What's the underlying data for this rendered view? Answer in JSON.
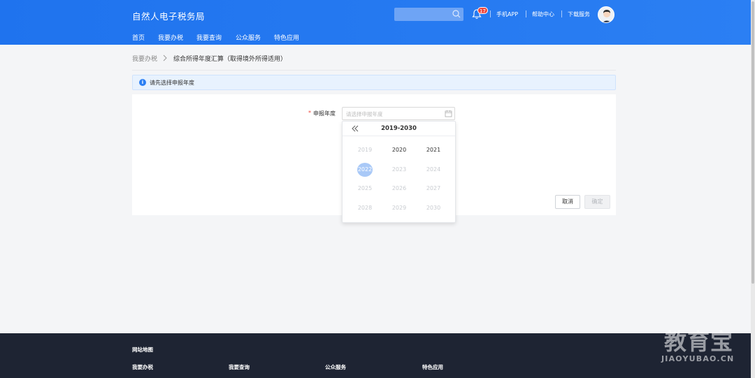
{
  "header": {
    "brand": "自然人电子税务局",
    "notification_count": "17",
    "links": [
      "手机APP",
      "帮助中心",
      "下载服务"
    ]
  },
  "nav": [
    "首页",
    "我要办税",
    "我要查询",
    "公众服务",
    "特色应用"
  ],
  "breadcrumb": {
    "parent": "我要办税",
    "current": "综合所得年度汇算（取得境外所得适用）"
  },
  "notice": {
    "text": "请先选择申报年度"
  },
  "form": {
    "required_mark": "*",
    "label": "申报年度",
    "placeholder": "请选择申报年度",
    "cancel_label": "取消",
    "confirm_label": "确定"
  },
  "year_picker": {
    "range_label": "2019-2030",
    "years": [
      "2019",
      "2020",
      "2021",
      "2022",
      "2023",
      "2024",
      "2025",
      "2026",
      "2027",
      "2028",
      "2029",
      "2030"
    ],
    "selected": "2022",
    "enabled": [
      "2020",
      "2021"
    ]
  },
  "footer": {
    "title": "网站地图",
    "columns": [
      "我要办税",
      "我要查询",
      "公众服务",
      "特色应用"
    ]
  },
  "watermark": {
    "cn": "教育宝",
    "en": "JIAOYUBAO.CN"
  },
  "colors": {
    "primary": "#2b7ff3",
    "footer": "#1e2433",
    "danger": "#f0483e"
  }
}
